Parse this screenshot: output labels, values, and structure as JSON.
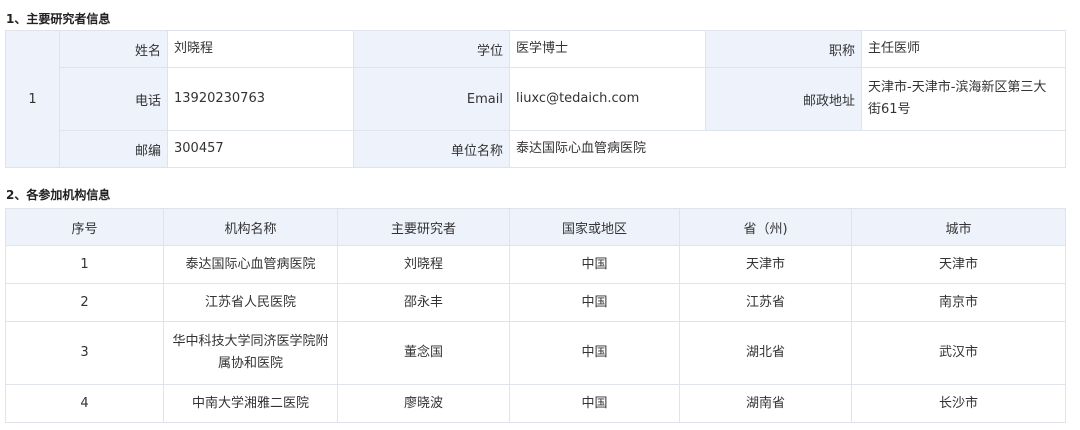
{
  "section1": {
    "title": "1、主要研究者信息",
    "index": "1",
    "name_label": "姓名",
    "name": "刘晓程",
    "degree_label": "学位",
    "degree": "医学博士",
    "title_label": "职称",
    "job_title": "主任医师",
    "phone_label": "电话",
    "phone": "13920230763",
    "email_label": "Email",
    "email": "liuxc@tedaich.com",
    "address_label": "邮政地址",
    "address": "天津市-天津市-滨海新区第三大街61号",
    "zip_label": "邮编",
    "zip": "300457",
    "org_label": "单位名称",
    "org": "泰达国际心血管病医院"
  },
  "section2": {
    "title": "2、各参加机构信息",
    "headers": [
      "序号",
      "机构名称",
      "主要研究者",
      "国家或地区",
      "省（州)",
      "城市"
    ],
    "rows": [
      [
        "1",
        "泰达国际心血管病医院",
        "刘晓程",
        "中国",
        "天津市",
        "天津市"
      ],
      [
        "2",
        "江苏省人民医院",
        "邵永丰",
        "中国",
        "江苏省",
        "南京市"
      ],
      [
        "3",
        "华中科技大学同济医学院附属协和医院",
        "董念国",
        "中国",
        "湖北省",
        "武汉市"
      ],
      [
        "4",
        "中南大学湘雅二医院",
        "廖晓波",
        "中国",
        "湖南省",
        "长沙市"
      ]
    ]
  }
}
